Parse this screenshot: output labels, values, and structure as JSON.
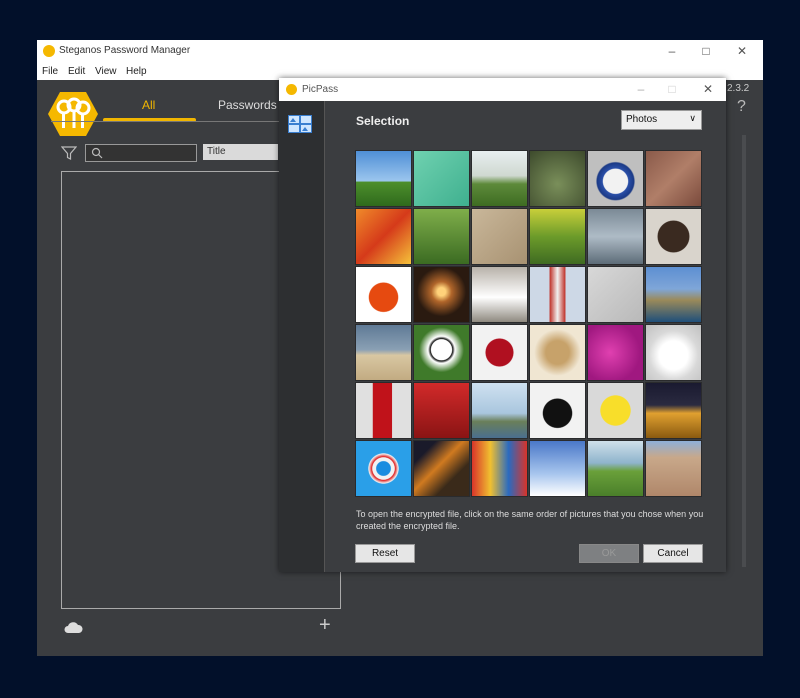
{
  "main_window": {
    "title": "Steganos Password Manager",
    "menu": [
      "File",
      "Edit",
      "View",
      "Help"
    ],
    "tabs": {
      "all": "All",
      "passwords": "Passwords"
    },
    "sort_select": "Title",
    "version_fragment": "2.3.2",
    "help_label": "?"
  },
  "dialog": {
    "title": "PicPass",
    "heading": "Selection",
    "dropdown_value": "Photos",
    "instructions": "To open the encrypted file, click on the same order of pictures that you chose when you created the encrypted file.",
    "buttons": {
      "reset": "Reset",
      "ok": "OK",
      "cancel": "Cancel"
    },
    "pictures": [
      [
        "tree",
        "scissors",
        "palm",
        "cactus",
        "bowl",
        "brick"
      ],
      [
        "gift-bag",
        "stork",
        "sand",
        "field",
        "sea",
        "monkey"
      ],
      [
        "apple",
        "candle",
        "horse",
        "lighthouse",
        "knife",
        "cliff"
      ],
      [
        "dog",
        "football",
        "leaf",
        "spices",
        "flowers",
        "cloud"
      ],
      [
        "extinguisher",
        "fire-truck",
        "bridge",
        "telephone",
        "smiley",
        "theater"
      ],
      [
        "lifebuoy",
        "night-road",
        "carousel",
        "sky",
        "deer",
        "building"
      ]
    ]
  },
  "colors": {
    "accent": "#f1b600",
    "window_bg": "#3b3d40",
    "desktop": "#02102a"
  }
}
